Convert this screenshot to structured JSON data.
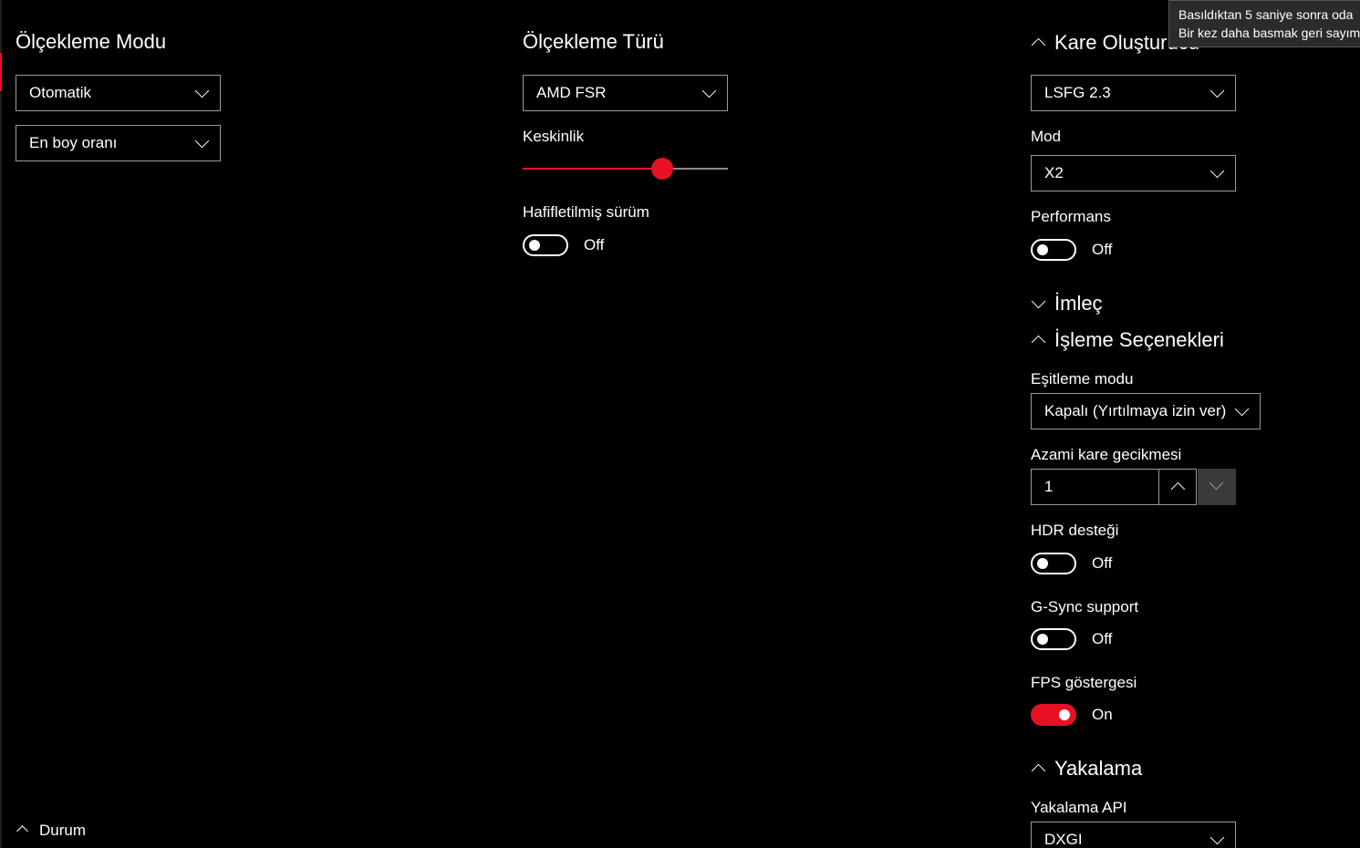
{
  "scaling_mode": {
    "title": "Ölçekleme Modu",
    "mode_select": "Otomatik",
    "aspect_select": "En boy oranı"
  },
  "scaling_type": {
    "title": "Ölçekleme Türü",
    "type_select": "AMD FSR",
    "sharpness_label": "Keskinlik",
    "sharpness_value_fraction": 0.68,
    "lite_label": "Hafifletilmiş sürüm",
    "lite_state": "Off"
  },
  "frame_gen": {
    "title": "Kare Oluşturucu",
    "version_select": "LSFG 2.3",
    "mode_label": "Mod",
    "mode_select": "X2",
    "performance_label": "Performans",
    "performance_state": "Off"
  },
  "cursor": {
    "title": "İmleç"
  },
  "render_options": {
    "title": "İşleme Seçenekleri",
    "sync_label": "Eşitleme modu",
    "sync_select": "Kapalı (Yırtılmaya izin ver)",
    "latency_label": "Azami kare gecikmesi",
    "latency_value": "1",
    "hdr_label": "HDR desteği",
    "hdr_state": "Off",
    "gsync_label": "G-Sync support",
    "gsync_state": "Off",
    "fps_label": "FPS göstergesi",
    "fps_state": "On"
  },
  "capture": {
    "title": "Yakalama",
    "api_label": "Yakalama API",
    "api_select": "DXGI"
  },
  "status": {
    "label": "Durum"
  },
  "tooltip": {
    "line1": "Basıldıktan 5 saniye sonra oda",
    "line2": "Bir kez daha basmak geri sayım"
  },
  "colors": {
    "accent": "#e81123",
    "background": "#000000",
    "text": "#ffffff"
  }
}
